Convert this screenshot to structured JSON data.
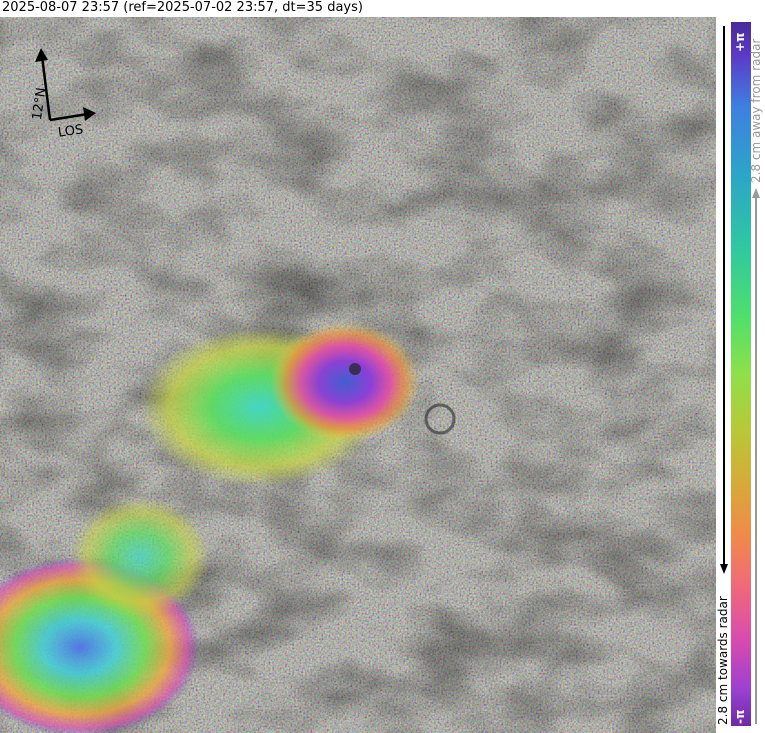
{
  "title": "2025-08-07 23:57 (ref=2025-07-02 23:57, dt=35 days)",
  "compass": {
    "north_label": "12°N",
    "los_label": "LOS"
  },
  "colorbar": {
    "top_label": "+π",
    "bottom_label": "-π",
    "away_label": "2.8 cm away from radar",
    "towards_label": "2.8 cm towards radar"
  }
}
